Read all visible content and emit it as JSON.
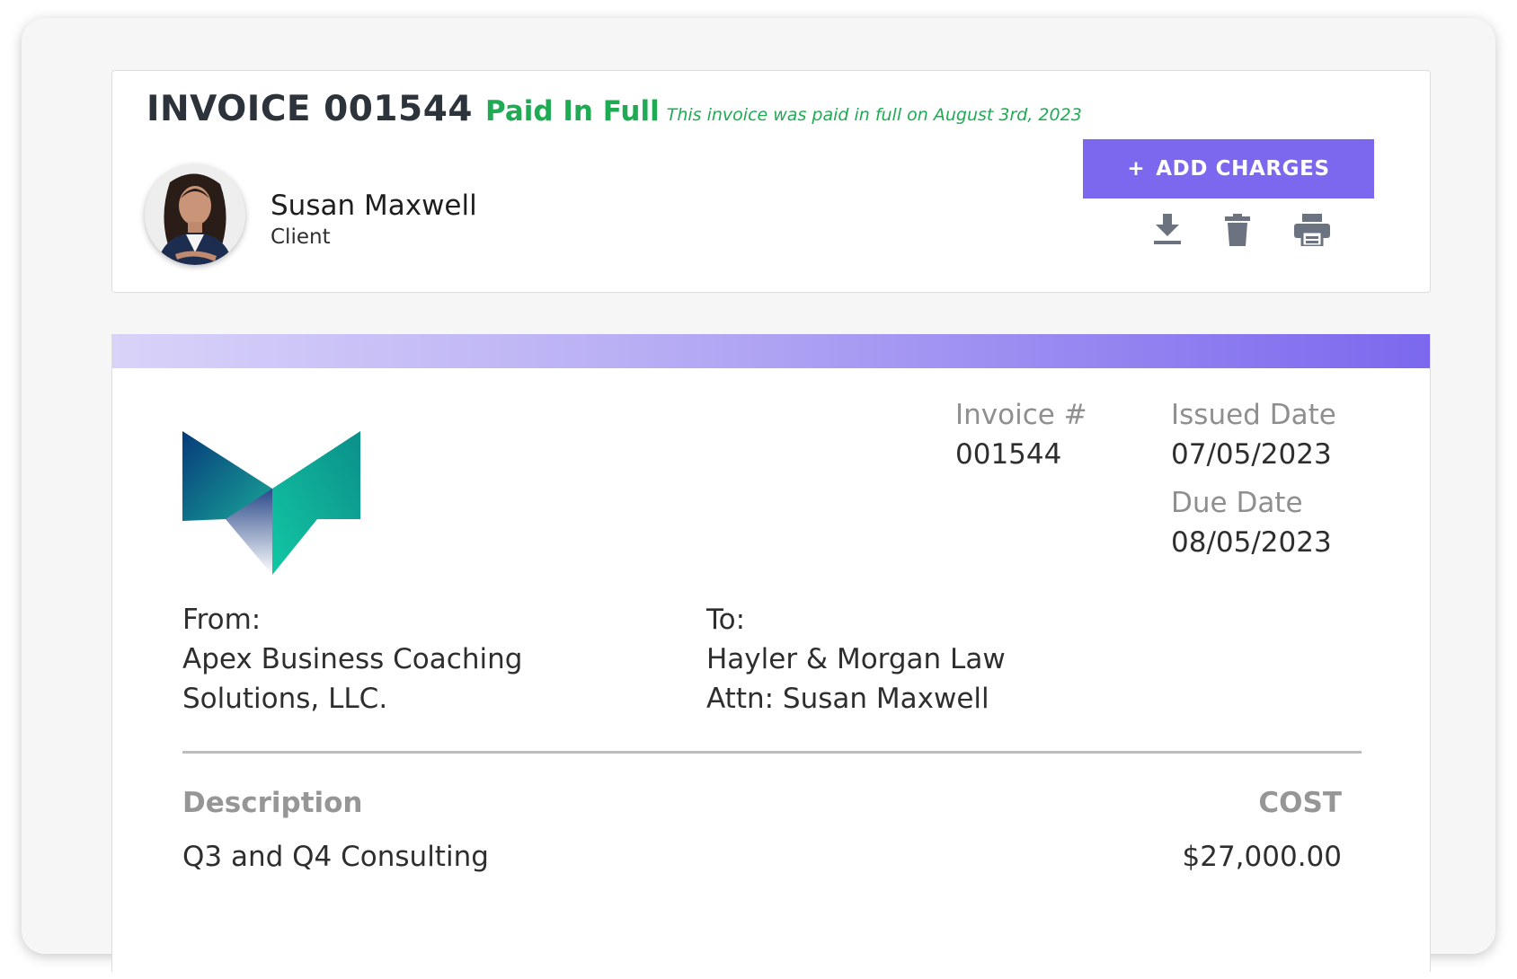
{
  "header": {
    "invoice_title": "INVOICE 001544",
    "status": "Paid In Full",
    "status_note": "This invoice was paid in full on August 3rd, 2023",
    "client": {
      "name": "Susan Maxwell",
      "role": "Client"
    },
    "actions": {
      "add_charges_icon": "+",
      "add_charges_label": "ADD CHARGES",
      "icons": [
        "download-icon",
        "trash-icon",
        "print-icon"
      ]
    }
  },
  "invoice": {
    "number_label": "Invoice #",
    "number": "001544",
    "issued_label": "Issued Date",
    "issued": "07/05/2023",
    "due_label": "Due Date",
    "due": "08/05/2023",
    "from": {
      "label": "From:",
      "lines": [
        "Apex Business Coaching",
        "Solutions, LLC."
      ]
    },
    "to": {
      "label": "To:",
      "lines": [
        "Hayler & Morgan Law",
        "Attn: Susan Maxwell"
      ]
    },
    "table": {
      "headers": [
        "Description",
        "COST"
      ],
      "rows": [
        [
          "Q3 and Q4 Consulting",
          "$27,000.00"
        ]
      ]
    }
  },
  "colors": {
    "accent": "#7b68ee",
    "paid_green": "#1fab54",
    "muted_label": "#8f8f8f",
    "icon_gray": "#6b7280"
  }
}
